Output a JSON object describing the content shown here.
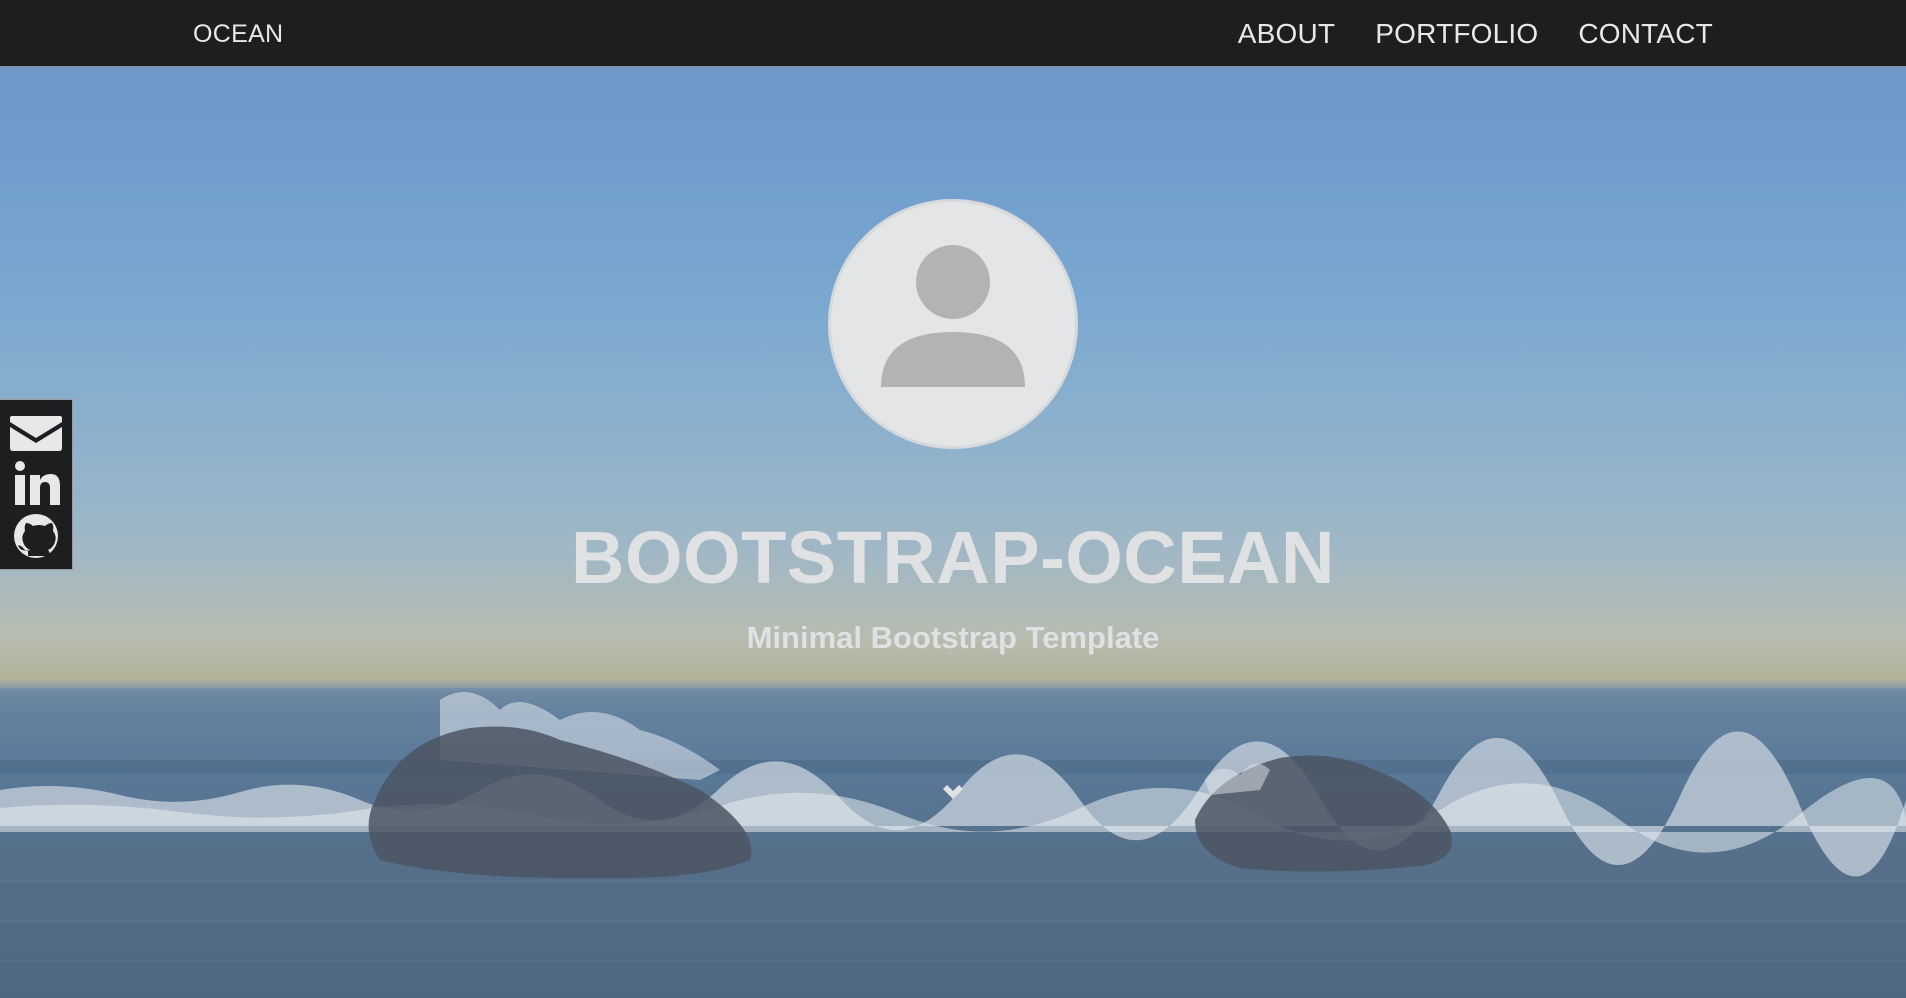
{
  "navbar": {
    "brand": "OCEAN",
    "links": [
      "ABOUT",
      "PORTFOLIO",
      "CONTACT"
    ]
  },
  "social": {
    "icons": [
      "envelope-icon",
      "linkedin-icon",
      "github-icon"
    ]
  },
  "hero": {
    "title": "BOOTSTRAP-OCEAN",
    "subtitle": "Minimal Bootstrap Template",
    "avatar_icon": "user-icon",
    "scroll_icon": "chevron-down-icon"
  },
  "colors": {
    "navbar_bg": "#1d1e20",
    "nav_text": "#e8e8e8",
    "hero_text": "#dfe1e3",
    "avatar_bg": "#e4e5e7",
    "avatar_figure": "#b1b3b5"
  }
}
